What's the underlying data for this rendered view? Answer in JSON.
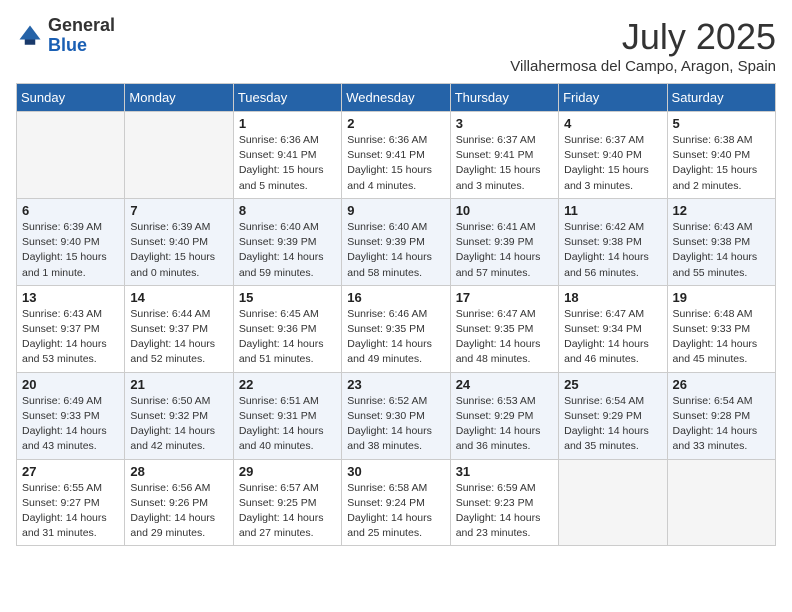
{
  "logo": {
    "general": "General",
    "blue": "Blue"
  },
  "title": "July 2025",
  "location": "Villahermosa del Campo, Aragon, Spain",
  "weekdays": [
    "Sunday",
    "Monday",
    "Tuesday",
    "Wednesday",
    "Thursday",
    "Friday",
    "Saturday"
  ],
  "weeks": [
    [
      {
        "day": "",
        "empty": true
      },
      {
        "day": "",
        "empty": true
      },
      {
        "day": "1",
        "info": "Sunrise: 6:36 AM\nSunset: 9:41 PM\nDaylight: 15 hours and 5 minutes."
      },
      {
        "day": "2",
        "info": "Sunrise: 6:36 AM\nSunset: 9:41 PM\nDaylight: 15 hours and 4 minutes."
      },
      {
        "day": "3",
        "info": "Sunrise: 6:37 AM\nSunset: 9:41 PM\nDaylight: 15 hours and 3 minutes."
      },
      {
        "day": "4",
        "info": "Sunrise: 6:37 AM\nSunset: 9:40 PM\nDaylight: 15 hours and 3 minutes."
      },
      {
        "day": "5",
        "info": "Sunrise: 6:38 AM\nSunset: 9:40 PM\nDaylight: 15 hours and 2 minutes."
      }
    ],
    [
      {
        "day": "6",
        "info": "Sunrise: 6:39 AM\nSunset: 9:40 PM\nDaylight: 15 hours and 1 minute."
      },
      {
        "day": "7",
        "info": "Sunrise: 6:39 AM\nSunset: 9:40 PM\nDaylight: 15 hours and 0 minutes."
      },
      {
        "day": "8",
        "info": "Sunrise: 6:40 AM\nSunset: 9:39 PM\nDaylight: 14 hours and 59 minutes."
      },
      {
        "day": "9",
        "info": "Sunrise: 6:40 AM\nSunset: 9:39 PM\nDaylight: 14 hours and 58 minutes."
      },
      {
        "day": "10",
        "info": "Sunrise: 6:41 AM\nSunset: 9:39 PM\nDaylight: 14 hours and 57 minutes."
      },
      {
        "day": "11",
        "info": "Sunrise: 6:42 AM\nSunset: 9:38 PM\nDaylight: 14 hours and 56 minutes."
      },
      {
        "day": "12",
        "info": "Sunrise: 6:43 AM\nSunset: 9:38 PM\nDaylight: 14 hours and 55 minutes."
      }
    ],
    [
      {
        "day": "13",
        "info": "Sunrise: 6:43 AM\nSunset: 9:37 PM\nDaylight: 14 hours and 53 minutes."
      },
      {
        "day": "14",
        "info": "Sunrise: 6:44 AM\nSunset: 9:37 PM\nDaylight: 14 hours and 52 minutes."
      },
      {
        "day": "15",
        "info": "Sunrise: 6:45 AM\nSunset: 9:36 PM\nDaylight: 14 hours and 51 minutes."
      },
      {
        "day": "16",
        "info": "Sunrise: 6:46 AM\nSunset: 9:35 PM\nDaylight: 14 hours and 49 minutes."
      },
      {
        "day": "17",
        "info": "Sunrise: 6:47 AM\nSunset: 9:35 PM\nDaylight: 14 hours and 48 minutes."
      },
      {
        "day": "18",
        "info": "Sunrise: 6:47 AM\nSunset: 9:34 PM\nDaylight: 14 hours and 46 minutes."
      },
      {
        "day": "19",
        "info": "Sunrise: 6:48 AM\nSunset: 9:33 PM\nDaylight: 14 hours and 45 minutes."
      }
    ],
    [
      {
        "day": "20",
        "info": "Sunrise: 6:49 AM\nSunset: 9:33 PM\nDaylight: 14 hours and 43 minutes."
      },
      {
        "day": "21",
        "info": "Sunrise: 6:50 AM\nSunset: 9:32 PM\nDaylight: 14 hours and 42 minutes."
      },
      {
        "day": "22",
        "info": "Sunrise: 6:51 AM\nSunset: 9:31 PM\nDaylight: 14 hours and 40 minutes."
      },
      {
        "day": "23",
        "info": "Sunrise: 6:52 AM\nSunset: 9:30 PM\nDaylight: 14 hours and 38 minutes."
      },
      {
        "day": "24",
        "info": "Sunrise: 6:53 AM\nSunset: 9:29 PM\nDaylight: 14 hours and 36 minutes."
      },
      {
        "day": "25",
        "info": "Sunrise: 6:54 AM\nSunset: 9:29 PM\nDaylight: 14 hours and 35 minutes."
      },
      {
        "day": "26",
        "info": "Sunrise: 6:54 AM\nSunset: 9:28 PM\nDaylight: 14 hours and 33 minutes."
      }
    ],
    [
      {
        "day": "27",
        "info": "Sunrise: 6:55 AM\nSunset: 9:27 PM\nDaylight: 14 hours and 31 minutes."
      },
      {
        "day": "28",
        "info": "Sunrise: 6:56 AM\nSunset: 9:26 PM\nDaylight: 14 hours and 29 minutes."
      },
      {
        "day": "29",
        "info": "Sunrise: 6:57 AM\nSunset: 9:25 PM\nDaylight: 14 hours and 27 minutes."
      },
      {
        "day": "30",
        "info": "Sunrise: 6:58 AM\nSunset: 9:24 PM\nDaylight: 14 hours and 25 minutes."
      },
      {
        "day": "31",
        "info": "Sunrise: 6:59 AM\nSunset: 9:23 PM\nDaylight: 14 hours and 23 minutes."
      },
      {
        "day": "",
        "empty": true
      },
      {
        "day": "",
        "empty": true
      }
    ]
  ]
}
